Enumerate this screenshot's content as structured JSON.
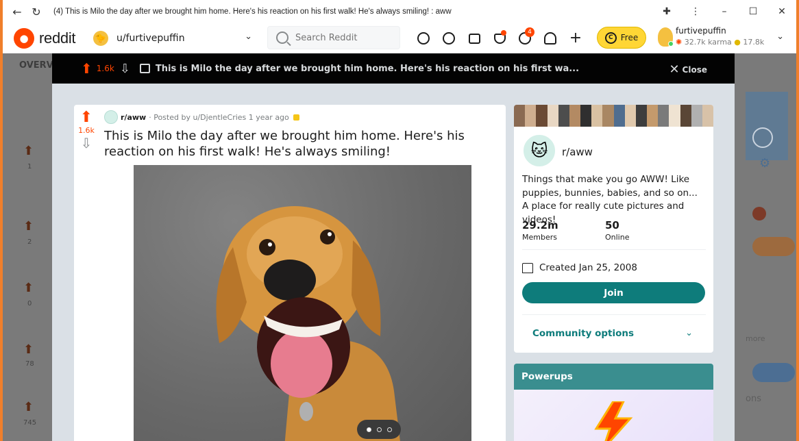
{
  "window": {
    "title": "(4) This is Milo the day after we brought him home. Here's his reaction on his first walk! He's always smiling! : aww"
  },
  "header": {
    "logo_text": "reddit",
    "community": "u/furtivepuffin",
    "search_placeholder": "Search Reddit",
    "chat_badge": "4",
    "free_label": "Free",
    "username": "furtivepuffin",
    "karma": "32.7k karma",
    "coins": "17.8k"
  },
  "background": {
    "overview_label": "OVERVI",
    "counts": [
      "1",
      "2",
      "0",
      "78",
      "745"
    ]
  },
  "post_bar": {
    "votes": "1.6k",
    "title": "This is Milo the day after we brought him home. Here's his reaction on his first wa...",
    "close_label": "Close"
  },
  "post": {
    "votes": "1.6k",
    "subreddit": "r/aww",
    "posted_by": "· Posted by u/DjentleCries 1 year ago",
    "title": "This is Milo the day after we brought him home. Here's his reaction on his first walk! He's always smiling!"
  },
  "sidebar": {
    "name": "r/aww",
    "description": "Things that make you go AWW! Like puppies, bunnies, babies, and so on... A place for really cute pictures and videos!",
    "members_value": "29.2m",
    "members_label": "Members",
    "online_value": "50",
    "online_label": "Online",
    "created": "Created Jan 25, 2008",
    "join_label": "Join",
    "community_options": "Community options",
    "powerups": "Powerups",
    "banner_colors": [
      "#8a6a52",
      "#cfae8f",
      "#6b4a34",
      "#e8d7c3",
      "#4d4d4d",
      "#b38a63",
      "#2f2f2f",
      "#d9c1a2",
      "#a98763",
      "#4f6d8f",
      "#e0c9ad",
      "#3d3d3d",
      "#c49a6c",
      "#7a7a7a",
      "#efe3d2",
      "#5a4636",
      "#b0b0b0",
      "#d8c2a8"
    ]
  },
  "right_sliver": {
    "more": "more",
    "ons": "ons"
  },
  "colors": {
    "accent": "#ff4500",
    "teal": "#0e7c7b",
    "browser_frame": "#f07f2b"
  }
}
